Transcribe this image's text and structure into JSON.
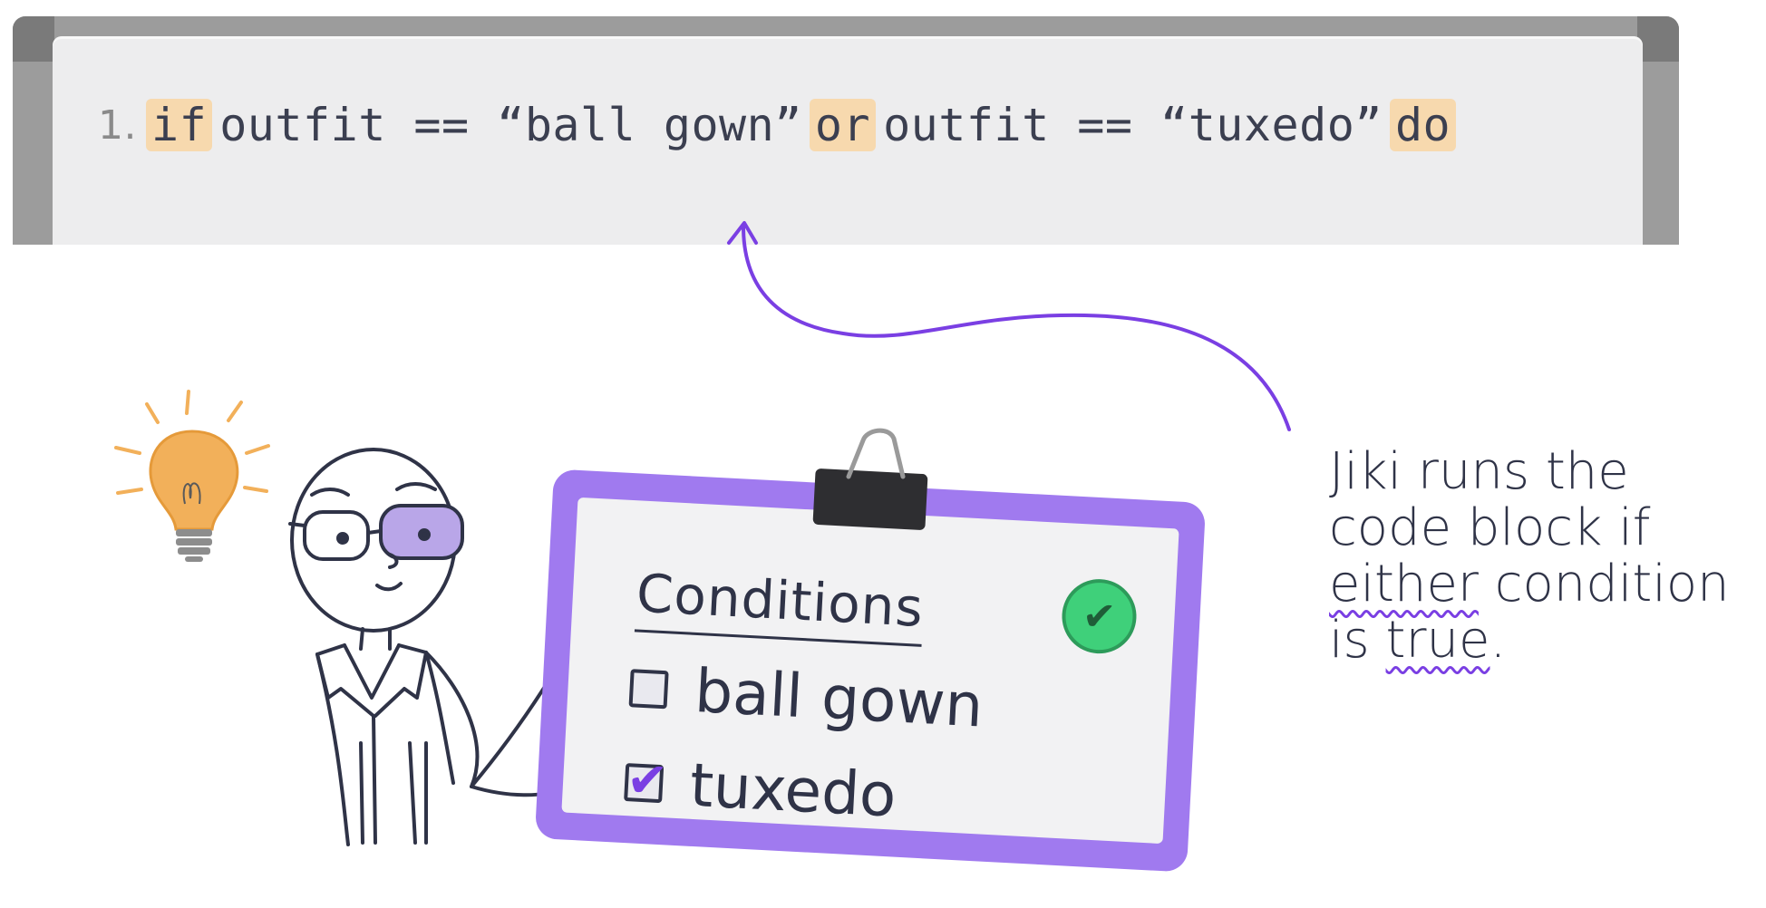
{
  "code": {
    "line_number": "1.",
    "tokens": [
      {
        "text": "if",
        "keyword": true
      },
      {
        "text": "outfit == “ball gown”",
        "keyword": false
      },
      {
        "text": "or",
        "keyword": true
      },
      {
        "text": "outfit == “tuxedo”",
        "keyword": false
      },
      {
        "text": "do",
        "keyword": true
      }
    ]
  },
  "clipboard": {
    "title": "Conditions",
    "items": [
      {
        "label": "ball gown",
        "checked": false
      },
      {
        "label": "tuxedo",
        "checked": true
      }
    ],
    "status_icon": "check-circle-icon"
  },
  "annotation": {
    "line1": "Jiki runs the",
    "line2": "code block if",
    "either": "either",
    "condition": " condition",
    "is": "is ",
    "true": "true",
    "period": "."
  },
  "colors": {
    "keyword_highlight": "#f7d9ae",
    "accent_purple": "#7a3fe3",
    "clipboard_purple": "#a07aef",
    "success_green": "#3fd07a",
    "ink": "#2f3347"
  },
  "icons": [
    "lightbulb-icon",
    "binder-clip-icon",
    "check-circle-icon",
    "arrow-icon",
    "character-illustration"
  ]
}
